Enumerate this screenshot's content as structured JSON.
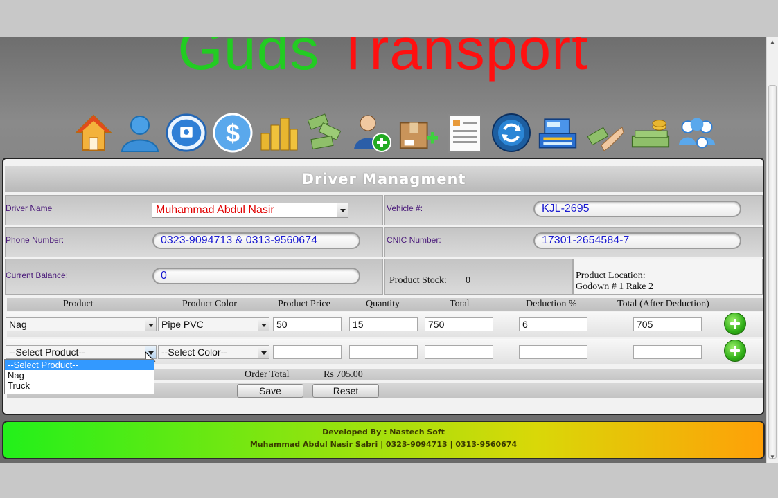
{
  "header": {
    "title_part1": "Guds",
    "title_part2": "Transport"
  },
  "toolbar": {
    "icons": [
      "home-icon",
      "user-icon",
      "disk-icon",
      "dollar-icon",
      "coins-icon",
      "money-flying-icon",
      "add-user-icon",
      "add-package-icon",
      "report-icon",
      "refresh-icon",
      "cash-register-icon",
      "payment-hand-icon",
      "cash-stack-icon",
      "user-group-icon"
    ]
  },
  "panel": {
    "title": "Driver Managment",
    "driver_name_label": "Driver Name",
    "driver_name_value": "Muhammad Abdul Nasir",
    "vehicle_label": "Vehicle #:",
    "vehicle_value": "KJL-2695",
    "phone_label": "Phone Number:",
    "phone_value": "0323-9094713 & 0313-9560674",
    "cnic_label": "CNIC Number:",
    "cnic_value": "17301-2654584-7",
    "balance_label": "Current Balance:",
    "balance_value": "0",
    "stock_label": "Product Stock:",
    "stock_value": "0",
    "location_label": "Product Location:",
    "location_value": "Godown # 1 Rake 2"
  },
  "order": {
    "columns": [
      "Product",
      "Product Color",
      "Product Price",
      "Quantity",
      "Total",
      "Deduction %",
      "Total (After Deduction)"
    ],
    "row1": {
      "product": "Nag",
      "color": "Pipe PVC",
      "price": "50",
      "quantity": "15",
      "total": "750",
      "deduction": "6",
      "after": "705"
    },
    "row2": {
      "product": "--Select Product--",
      "color": "--Select Color--",
      "price": "",
      "quantity": "",
      "total": "",
      "deduction": "",
      "after": ""
    },
    "product_options": [
      "--Select Product--",
      "Nag",
      "Truck"
    ],
    "order_total_label": "Order Total",
    "order_total_value": "Rs 705.00",
    "save_label": "Save",
    "reset_label": "Reset"
  },
  "footer": {
    "line1": "Developed By : Nastech Soft",
    "line2": "Muhammad Abdul Nasir Sabri | 0323-9094713 | 0313-9560674"
  }
}
